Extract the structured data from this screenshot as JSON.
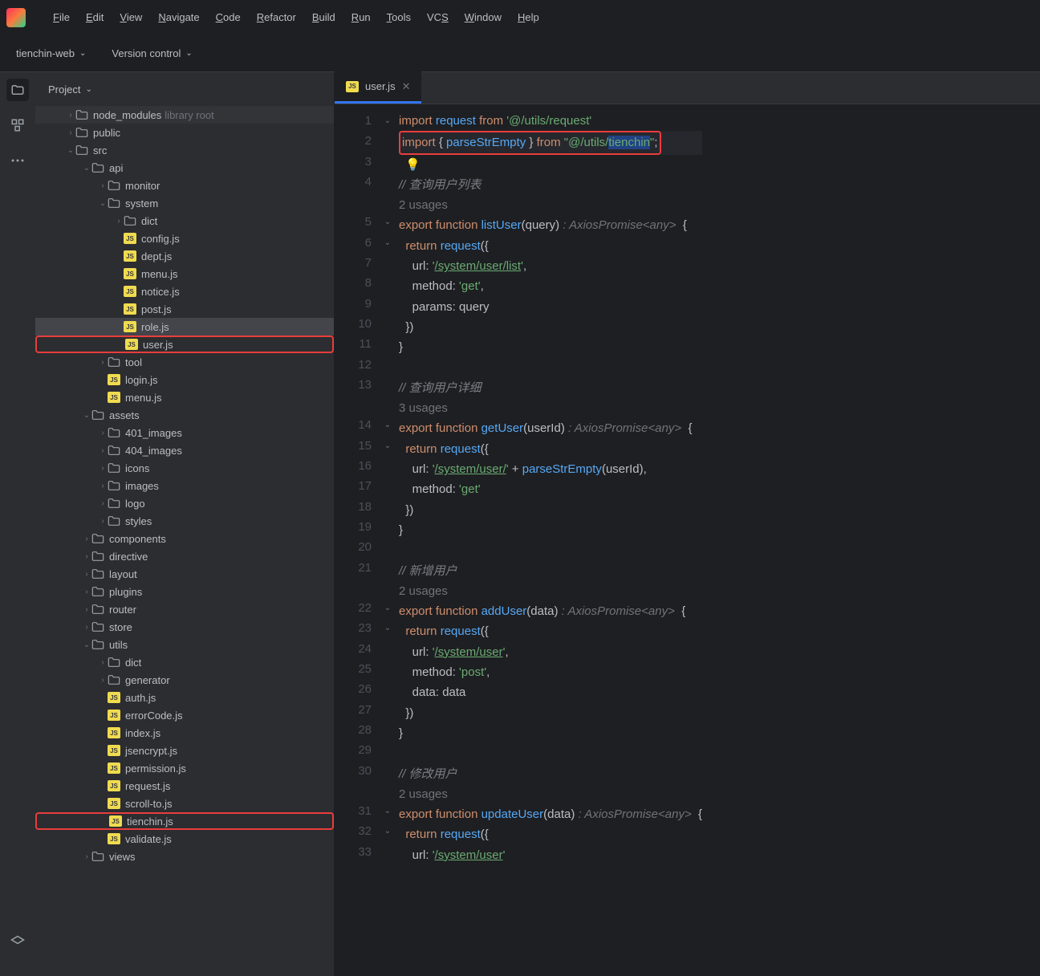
{
  "menubar": {
    "items": [
      "File",
      "Edit",
      "View",
      "Navigate",
      "Code",
      "Refactor",
      "Build",
      "Run",
      "Tools",
      "VCS",
      "Window",
      "Help"
    ],
    "underlines": [
      "F",
      "E",
      "V",
      "N",
      "C",
      "R",
      "B",
      "R",
      "T",
      "S",
      "W",
      "H"
    ]
  },
  "toolbar": {
    "project": "tienchin-web",
    "vc": "Version control"
  },
  "sidebar": {
    "title": "Project"
  },
  "tree": [
    {
      "d": 1,
      "t": "folder",
      "arrow": ">",
      "label": "node_modules",
      "note": "library root",
      "shade": true
    },
    {
      "d": 1,
      "t": "folder",
      "arrow": ">",
      "label": "public"
    },
    {
      "d": 1,
      "t": "folder",
      "arrow": "v",
      "label": "src"
    },
    {
      "d": 2,
      "t": "folder",
      "arrow": "v",
      "label": "api"
    },
    {
      "d": 3,
      "t": "folder",
      "arrow": ">",
      "label": "monitor"
    },
    {
      "d": 3,
      "t": "folder",
      "arrow": "v",
      "label": "system"
    },
    {
      "d": 4,
      "t": "folder",
      "arrow": ">",
      "label": "dict"
    },
    {
      "d": 4,
      "t": "js",
      "label": "config.js"
    },
    {
      "d": 4,
      "t": "js",
      "label": "dept.js"
    },
    {
      "d": 4,
      "t": "js",
      "label": "menu.js"
    },
    {
      "d": 4,
      "t": "js",
      "label": "notice.js"
    },
    {
      "d": 4,
      "t": "js",
      "label": "post.js"
    },
    {
      "d": 4,
      "t": "js",
      "label": "role.js",
      "sel": true
    },
    {
      "d": 4,
      "t": "js",
      "label": "user.js",
      "red": true
    },
    {
      "d": 3,
      "t": "folder",
      "arrow": ">",
      "label": "tool"
    },
    {
      "d": 3,
      "t": "js",
      "label": "login.js"
    },
    {
      "d": 3,
      "t": "js",
      "label": "menu.js"
    },
    {
      "d": 2,
      "t": "folder",
      "arrow": "v",
      "label": "assets"
    },
    {
      "d": 3,
      "t": "folder",
      "arrow": ">",
      "label": "401_images"
    },
    {
      "d": 3,
      "t": "folder",
      "arrow": ">",
      "label": "404_images"
    },
    {
      "d": 3,
      "t": "folder",
      "arrow": ">",
      "label": "icons"
    },
    {
      "d": 3,
      "t": "folder",
      "arrow": ">",
      "label": "images"
    },
    {
      "d": 3,
      "t": "folder",
      "arrow": ">",
      "label": "logo"
    },
    {
      "d": 3,
      "t": "folder",
      "arrow": ">",
      "label": "styles"
    },
    {
      "d": 2,
      "t": "folder",
      "arrow": ">",
      "label": "components"
    },
    {
      "d": 2,
      "t": "folder",
      "arrow": ">",
      "label": "directive"
    },
    {
      "d": 2,
      "t": "folder",
      "arrow": ">",
      "label": "layout"
    },
    {
      "d": 2,
      "t": "folder",
      "arrow": ">",
      "label": "plugins"
    },
    {
      "d": 2,
      "t": "folder",
      "arrow": ">",
      "label": "router"
    },
    {
      "d": 2,
      "t": "folder",
      "arrow": ">",
      "label": "store"
    },
    {
      "d": 2,
      "t": "folder",
      "arrow": "v",
      "label": "utils"
    },
    {
      "d": 3,
      "t": "folder",
      "arrow": ">",
      "label": "dict"
    },
    {
      "d": 3,
      "t": "folder",
      "arrow": ">",
      "label": "generator"
    },
    {
      "d": 3,
      "t": "js",
      "label": "auth.js"
    },
    {
      "d": 3,
      "t": "js",
      "label": "errorCode.js"
    },
    {
      "d": 3,
      "t": "js",
      "label": "index.js"
    },
    {
      "d": 3,
      "t": "js",
      "label": "jsencrypt.js"
    },
    {
      "d": 3,
      "t": "js",
      "label": "permission.js"
    },
    {
      "d": 3,
      "t": "js",
      "label": "request.js"
    },
    {
      "d": 3,
      "t": "js",
      "label": "scroll-to.js"
    },
    {
      "d": 3,
      "t": "js",
      "label": "tienchin.js",
      "red": true
    },
    {
      "d": 3,
      "t": "js",
      "label": "validate.js"
    },
    {
      "d": 2,
      "t": "folder",
      "arrow": ">",
      "label": "views"
    }
  ],
  "tab": {
    "filename": "user.js"
  },
  "code": {
    "lines": [
      {
        "n": 1,
        "fold": "v",
        "html": "<span class='kw'>import</span> <span class='fn'>request</span> <span class='kw'>from</span> <span class='str'>'@/utils/request'</span>"
      },
      {
        "n": 2,
        "hl": true,
        "redbox": true,
        "html": "<span class='kw'>import</span> { <span class='fn'>parseStrEmpty</span> } <span class='kw'>from</span> <span class='str'>\"@/utils/<span class='sel-bg'>tienchin</span>\"</span>;"
      },
      {
        "n": 3,
        "html": "  <span class='bulb'>💡</span>"
      },
      {
        "n": 4,
        "html": "<span class='cmt'>// 查询用户列表</span>"
      },
      {
        "n": "",
        "html": "<span class='hint'>2 usages</span>"
      },
      {
        "n": 5,
        "fold": "v",
        "html": "<span class='kw'>export</span> <span class='kw'>function</span> <span class='fn'>listUser</span>(<span class='param'>query</span>) <span class='type'>: AxiosPromise&lt;any&gt;</span>  {"
      },
      {
        "n": 6,
        "fold": "v",
        "html": "  <span class='kw'>return</span> <span class='fn'>request</span>({"
      },
      {
        "n": 7,
        "html": "    url: <span class='str'>'<span class='url'>/system/user/list</span>'</span>,"
      },
      {
        "n": 8,
        "html": "    method: <span class='str'>'get'</span>,"
      },
      {
        "n": 9,
        "html": "    params: <span class='param'>query</span>"
      },
      {
        "n": 10,
        "html": "  })"
      },
      {
        "n": 11,
        "html": "}"
      },
      {
        "n": 12,
        "html": ""
      },
      {
        "n": 13,
        "html": "<span class='cmt'>// 查询用户详细</span>"
      },
      {
        "n": "",
        "html": "<span class='hint'>3 usages</span>"
      },
      {
        "n": 14,
        "fold": "v",
        "html": "<span class='kw'>export</span> <span class='kw'>function</span> <span class='fn'>getUser</span>(<span class='param'>userId</span>) <span class='type'>: AxiosPromise&lt;any&gt;</span>  {"
      },
      {
        "n": 15,
        "fold": "v",
        "html": "  <span class='kw'>return</span> <span class='fn'>request</span>({"
      },
      {
        "n": 16,
        "html": "    url: <span class='str'>'<span class='url'>/system/user/</span>'</span> + <span class='fn'>parseStrEmpty</span>(<span class='param'>userId</span>),"
      },
      {
        "n": 17,
        "html": "    method: <span class='str'>'get'</span>"
      },
      {
        "n": 18,
        "html": "  })"
      },
      {
        "n": 19,
        "html": "}"
      },
      {
        "n": 20,
        "html": ""
      },
      {
        "n": 21,
        "html": "<span class='cmt'>// 新增用户</span>"
      },
      {
        "n": "",
        "html": "<span class='hint'>2 usages</span>"
      },
      {
        "n": 22,
        "fold": "v",
        "html": "<span class='kw'>export</span> <span class='kw'>function</span> <span class='fn'>addUser</span>(<span class='param'>data</span>) <span class='type'>: AxiosPromise&lt;any&gt;</span>  {"
      },
      {
        "n": 23,
        "fold": "v",
        "html": "  <span class='kw'>return</span> <span class='fn'>request</span>({"
      },
      {
        "n": 24,
        "html": "    url: <span class='str'>'<span class='url'>/system/user</span>'</span>,"
      },
      {
        "n": 25,
        "html": "    method: <span class='str'>'post'</span>,"
      },
      {
        "n": 26,
        "html": "    data: <span class='param'>data</span>"
      },
      {
        "n": 27,
        "html": "  })"
      },
      {
        "n": 28,
        "html": "}"
      },
      {
        "n": 29,
        "html": ""
      },
      {
        "n": 30,
        "html": "<span class='cmt'>// 修改用户</span>"
      },
      {
        "n": "",
        "html": "<span class='hint'>2 usages</span>"
      },
      {
        "n": 31,
        "fold": "v",
        "html": "<span class='kw'>export</span> <span class='kw'>function</span> <span class='fn'>updateUser</span>(<span class='param'>data</span>) <span class='type'>: AxiosPromise&lt;any&gt;</span>  {"
      },
      {
        "n": 32,
        "fold": "v",
        "html": "  <span class='kw'>return</span> <span class='fn'>request</span>({"
      },
      {
        "n": 33,
        "html": "    url: <span class='str'>'<span class='url'>/system/user</span>'</span>"
      }
    ]
  }
}
